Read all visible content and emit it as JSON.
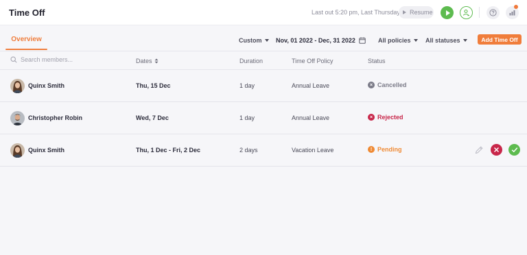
{
  "header": {
    "title": "Time Off",
    "last_out": "Last out 5:20 pm, Last Thursday",
    "resume_label": "Resume"
  },
  "toolbar": {
    "tab_overview": "Overview",
    "custom_label": "Custom",
    "date_range": "Nov, 01 2022 - Dec, 31 2022",
    "policies_label": "All policies",
    "statuses_label": "All statuses",
    "add_button": "Add Time Off"
  },
  "table": {
    "search_placeholder": "Search members...",
    "columns": {
      "dates": "Dates",
      "duration": "Duration",
      "policy": "Time Off Policy",
      "status": "Status"
    },
    "rows": [
      {
        "member": "Quinx Smith",
        "dates": "Thu, 15 Dec",
        "duration": "1 day",
        "policy": "Annual Leave",
        "status": "Cancelled"
      },
      {
        "member": "Christopher Robin",
        "dates": "Wed, 7 Dec",
        "duration": "1 day",
        "policy": "Annual Leave",
        "status": "Rejected"
      },
      {
        "member": "Quinx Smith",
        "dates": "Thu, 1 Dec - Fri, 2 Dec",
        "duration": "2 days",
        "policy": "Vacation Leave",
        "status": "Pending"
      }
    ]
  },
  "colors": {
    "accent": "#f07d3b",
    "green": "#5dbb4f",
    "cancelled": "#7b7b88",
    "rejected": "#c8274a",
    "pending": "#ef8a34"
  },
  "icons": {
    "search": "search-icon",
    "calendar": "calendar-icon",
    "play": "play-icon",
    "user": "user-icon",
    "help": "help-icon",
    "reports": "chart-icon",
    "edit": "pencil-icon",
    "reject": "close-icon",
    "approve": "check-icon"
  }
}
